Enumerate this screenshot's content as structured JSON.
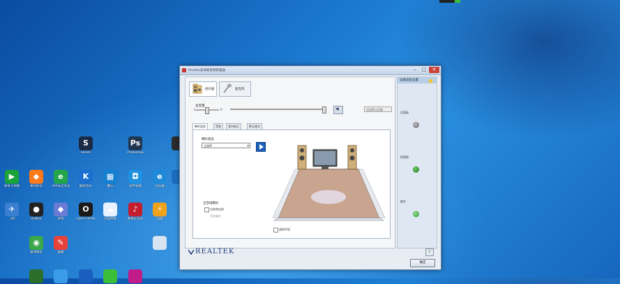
{
  "window": {
    "title": "Realtek高清晰音频管理器",
    "min": "–",
    "max": "▢",
    "close": "✕"
  },
  "main_tabs": [
    {
      "label": "扬声器",
      "icon": "speaker-icon"
    },
    {
      "label": "麦克风",
      "icon": "microphone-icon"
    }
  ],
  "volume": {
    "label": "主音量",
    "left_tick": "L",
    "right_tick": "R",
    "device_select": "设定默认设备"
  },
  "sub_tabs": [
    "喇叭组态",
    "音效",
    "室内校正",
    "默认格式"
  ],
  "config": {
    "label": "喇叭组态",
    "selected": "立体声",
    "group_label": "全音域喇叭",
    "option_front": "左前和右前",
    "option_surround": "环绕喇叭",
    "virtual_surround": "虚拟环绕"
  },
  "right_panel": {
    "title": "设备高级设置",
    "back_panel": "后面板",
    "front_panel": "前面板",
    "digital": "数字",
    "jacks": [
      "grey",
      "green",
      "lime"
    ]
  },
  "footer": {
    "brand": "REALTEK",
    "info": "i",
    "ok": "确定"
  },
  "desktop_icons": [
    {
      "label": "Steam",
      "color": "#1b2a44",
      "glyph": "S"
    },
    {
      "label": "Photoshop",
      "color": "#1f3550",
      "glyph": "Ps"
    },
    {
      "label": "",
      "color": "#2b2b2b",
      "glyph": ""
    },
    {
      "label": "爱奇艺视频",
      "color": "#1aa33a",
      "glyph": "▶"
    },
    {
      "label": "暴风影音",
      "color": "#ff7a1a",
      "glyph": "◆"
    },
    {
      "label": "360安全浏览器",
      "color": "#23a54a",
      "glyph": "e"
    },
    {
      "label": "酷狗音乐",
      "color": "#1a6fd1",
      "glyph": "K"
    },
    {
      "label": "魔方",
      "color": "#157fd0",
      "glyph": "▦"
    },
    {
      "label": "软件管理",
      "color": "#2090e0",
      "glyph": "◘"
    },
    {
      "label": "浏览器",
      "color": "#1f8ad9",
      "glyph": "e"
    },
    {
      "label": "",
      "color": "#1c6cc0",
      "glyph": ""
    },
    {
      "label": "飞鸽",
      "color": "#3a7fd0",
      "glyph": "✈"
    },
    {
      "label": "QQ影音",
      "color": "#222",
      "glyph": "●"
    },
    {
      "label": "游戏",
      "color": "#6a7bd6",
      "glyph": "◆"
    },
    {
      "label": "Opera Browser",
      "color": "#1a1a1a",
      "glyph": "O"
    },
    {
      "label": "百度网盘",
      "color": "#e8f1ff",
      "glyph": "☁"
    },
    {
      "label": "网易云音乐",
      "color": "#c41d2e",
      "glyph": "♪"
    },
    {
      "label": "迅雷",
      "color": "#f0a21a",
      "glyph": "⚡"
    },
    {
      "label": "驱动精灵",
      "color": "#3aa84a",
      "glyph": "◉"
    },
    {
      "label": "画图",
      "color": "#e8433a",
      "glyph": "✎"
    },
    {
      "label": "",
      "color": "#d8e4f2",
      "glyph": ""
    },
    {
      "label": "",
      "color": "#2a6e2a",
      "glyph": ""
    },
    {
      "label": "",
      "color": "#3a9be8",
      "glyph": ""
    },
    {
      "label": "",
      "color": "#1a5fbf",
      "glyph": ""
    },
    {
      "label": "",
      "color": "#3bbf3b",
      "glyph": ""
    },
    {
      "label": "",
      "color": "#c01d8a",
      "glyph": ""
    }
  ]
}
